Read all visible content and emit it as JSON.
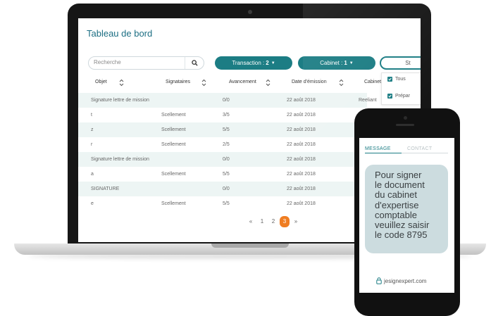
{
  "dashboard": {
    "title": "Tableau de bord",
    "search": {
      "placeholder": "Recherche"
    },
    "filters": {
      "transaction": {
        "label": "Transaction : ",
        "count": "2"
      },
      "cabinet": {
        "label": "Cabinet : ",
        "count": "1"
      },
      "status": {
        "label": "St"
      }
    },
    "dropdown": {
      "items": [
        "Tous",
        "Prépar"
      ]
    },
    "columns": [
      "Objet",
      "Signataires",
      "Avancement",
      "Date d'émission",
      "Cabinet"
    ],
    "rows": [
      {
        "objet": "Signature lettre de mission",
        "signataires": "",
        "avancement": "0/0",
        "date": "22 août 2018",
        "cabinet": "Reeliant"
      },
      {
        "objet": "t",
        "signataires": "Scellement",
        "avancement": "3/5",
        "date": "22 août 2018",
        "cabinet": ""
      },
      {
        "objet": "z",
        "signataires": "Scellement",
        "avancement": "5/5",
        "date": "22 août 2018",
        "cabinet": ""
      },
      {
        "objet": "r",
        "signataires": "Scellement",
        "avancement": "2/5",
        "date": "22 août 2018",
        "cabinet": ""
      },
      {
        "objet": "Signature lettre de mission",
        "signataires": "",
        "avancement": "0/0",
        "date": "22 août 2018",
        "cabinet": ""
      },
      {
        "objet": "a",
        "signataires": "Scellement",
        "avancement": "5/5",
        "date": "22 août 2018",
        "cabinet": ""
      },
      {
        "objet": "SIGNATURE",
        "signataires": "",
        "avancement": "0/0",
        "date": "22 août 2018",
        "cabinet": ""
      },
      {
        "objet": "e",
        "signataires": "Scellement",
        "avancement": "5/5",
        "date": "22 août 2018",
        "cabinet": ""
      }
    ],
    "pagination": {
      "prev": "«",
      "pages": [
        "1",
        "2",
        "3"
      ],
      "current": "3",
      "next": "»"
    }
  },
  "phone": {
    "tabs": {
      "message": "MESSAGE",
      "contact": "CONTACT"
    },
    "message_lines": [
      "Pour signer",
      "le document",
      "du cabinet",
      "d'expertise",
      "comptable",
      "veuillez saisir",
      "le code 8795"
    ],
    "site": "jesignexpert.com"
  },
  "colors": {
    "accent": "#1c7d84",
    "title": "#1c6e83",
    "row_alt": "#edf5f4",
    "page_active": "#ef7d22",
    "bubble": "#ccdcdf"
  },
  "icons": [
    "search-icon",
    "sort-icon",
    "caret-down-icon",
    "check-icon",
    "lock-icon"
  ]
}
